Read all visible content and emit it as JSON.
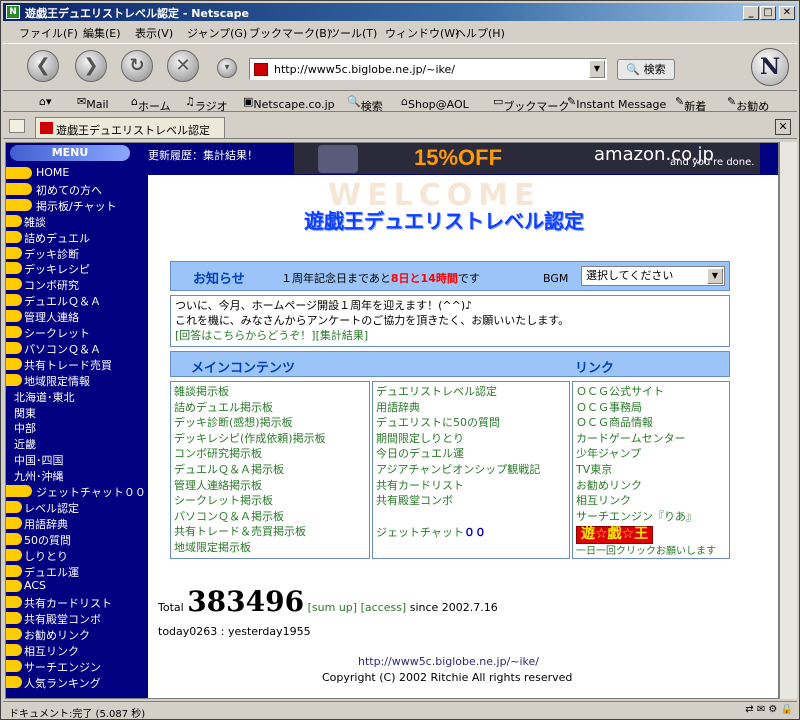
{
  "window": {
    "title": "遊戯王デュエリストレベル認定 - Netscape",
    "btn_min": "_",
    "btn_max": "□",
    "btn_close": "✕"
  },
  "menubar": [
    "ファイル(F)",
    "編集(E)",
    "表示(V)",
    "ジャンプ(G)",
    "ブックマーク(B)",
    "ツール(T)",
    "ウィンドウ(W)",
    "ヘルプ(H)"
  ],
  "nav": {
    "url": "http://www5c.biglobe.ne.jp/~ike/",
    "search_label": "🔍 検索",
    "logo": "N"
  },
  "personal": [
    "Mail",
    "ホーム",
    "ラジオ",
    "Netscape.co.jp",
    "検索",
    "Shop@AOL",
    "ブックマーク",
    "Instant Message",
    "新着",
    "お勧め"
  ],
  "tab": {
    "title": "遊戯王デュエリストレベル認定",
    "close": "✕"
  },
  "sidebar": {
    "header": "MENU",
    "items": [
      {
        "label": "HOME",
        "pill": true,
        "indent": false
      },
      {
        "label": "初めての方へ",
        "pill": true,
        "indent": false
      },
      {
        "label": "掲示板/チャット",
        "pill": true,
        "indent": false
      },
      {
        "label": "雑談",
        "pill": true,
        "indent": true
      },
      {
        "label": "詰めデュエル",
        "pill": true,
        "indent": true
      },
      {
        "label": "デッキ診断",
        "pill": true,
        "indent": true
      },
      {
        "label": "デッキレシピ",
        "pill": true,
        "indent": true
      },
      {
        "label": "コンボ研究",
        "pill": true,
        "indent": true
      },
      {
        "label": "デュエルＱ＆Ａ",
        "pill": true,
        "indent": true
      },
      {
        "label": "管理人連絡",
        "pill": true,
        "indent": true
      },
      {
        "label": "シークレット",
        "pill": true,
        "indent": true
      },
      {
        "label": "パソコンＱ＆Ａ",
        "pill": true,
        "indent": true
      },
      {
        "label": "共有トレード売買",
        "pill": true,
        "indent": true
      },
      {
        "label": "地域限定情報",
        "pill": true,
        "indent": true
      },
      {
        "label": "北海道･東北",
        "pill": false,
        "indent": false
      },
      {
        "label": "関東",
        "pill": false,
        "indent": false
      },
      {
        "label": "中部",
        "pill": false,
        "indent": false
      },
      {
        "label": "近畿",
        "pill": false,
        "indent": false
      },
      {
        "label": "中国･四国",
        "pill": false,
        "indent": false
      },
      {
        "label": "九州･沖縄",
        "pill": false,
        "indent": false
      },
      {
        "label": "ジェットチャット００",
        "pill": true,
        "indent": false
      },
      {
        "label": "レベル認定",
        "pill": true,
        "indent": true
      },
      {
        "label": "用語辞典",
        "pill": true,
        "indent": true
      },
      {
        "label": "50の質問",
        "pill": true,
        "indent": true
      },
      {
        "label": "しりとり",
        "pill": true,
        "indent": true
      },
      {
        "label": "デュエル運",
        "pill": true,
        "indent": true
      },
      {
        "label": "ACS",
        "pill": true,
        "indent": true
      },
      {
        "label": "共有カードリスト",
        "pill": true,
        "indent": true
      },
      {
        "label": "共有殿堂コンボ",
        "pill": true,
        "indent": true
      },
      {
        "label": "お勧めリンク",
        "pill": true,
        "indent": true
      },
      {
        "label": "相互リンク",
        "pill": true,
        "indent": true
      },
      {
        "label": "サーチエンジン",
        "pill": true,
        "indent": true
      },
      {
        "label": "人気ランキング",
        "pill": true,
        "indent": true
      }
    ]
  },
  "updates": "更新履歴：集計結果！",
  "banner": {
    "sale": "15%OFF",
    "brand": "amazon.co.jp",
    "tagline": "and you're done."
  },
  "main": {
    "welcome": "WELCOME",
    "title": "遊戯王デュエリストレベル認定",
    "notice_title": "お知らせ",
    "countdown_pre": "１周年記念日まであと",
    "countdown_days": "8日と14時間",
    "countdown_post": "です",
    "bgm_label": "BGM",
    "bgm_select": "選択してください",
    "notice_line1": "ついに、今月、ホームページ開設１周年を迎えます！(^^)♪",
    "notice_line2": "これを機に、みなさんからアンケートのご協力を頂きたく、お願いいたします。",
    "notice_link1": "[回答はこちらからどうぞ！]",
    "notice_link2": "[集計結果]",
    "main_contents": "メインコンテンツ",
    "links_title": "リンク",
    "col1": [
      "雑談掲示板",
      "詰めデュエル掲示板",
      "デッキ診断(感想)掲示板",
      "デッキレシピ(作成依頼)掲示板",
      "コンボ研究掲示板",
      "デュエルＱ＆Ａ掲示板",
      "管理人連絡掲示板",
      "シークレット掲示板",
      "パソコンＱ＆Ａ掲示板",
      "共有トレード＆売買掲示板",
      "地域限定掲示板"
    ],
    "col2": [
      "デュエリストレベル認定",
      "用語辞典",
      "デュエリストに50の質問",
      "期間限定しりとり",
      "今日のデュエル運",
      "アジアチャンピオンシップ観戦記",
      "共有カードリスト",
      "共有殿堂コンボ"
    ],
    "jet_chat": "ジェットチャット",
    "jet_oo": "００",
    "col3": [
      "ＯＣＧ公式サイト",
      "ＯＣＧ事務局",
      "ＯＣＧ商品情報",
      "カードゲームセンター",
      "少年ジャンプ",
      "TV東京",
      "お勧めリンク",
      "相互リンク",
      "サーチエンジン『りあ』"
    ],
    "yugioh_logo": "遊☆戯☆王",
    "click_note": "一日一回クリックお願いします"
  },
  "counter": {
    "total_label": "Total",
    "total": "383496",
    "sum_up": "[sum up]",
    "access": "[access]",
    "since": "since 2002.7.16",
    "today_line": "today0263 : yesterday1955"
  },
  "footer": {
    "url": "http://www5c.biglobe.ne.jp/~ike/",
    "copyright": "Copyright (C) 2002 Ritchie All rights reserved"
  },
  "status": {
    "text": "ドキュメント:完了 (5.087 秒)"
  }
}
